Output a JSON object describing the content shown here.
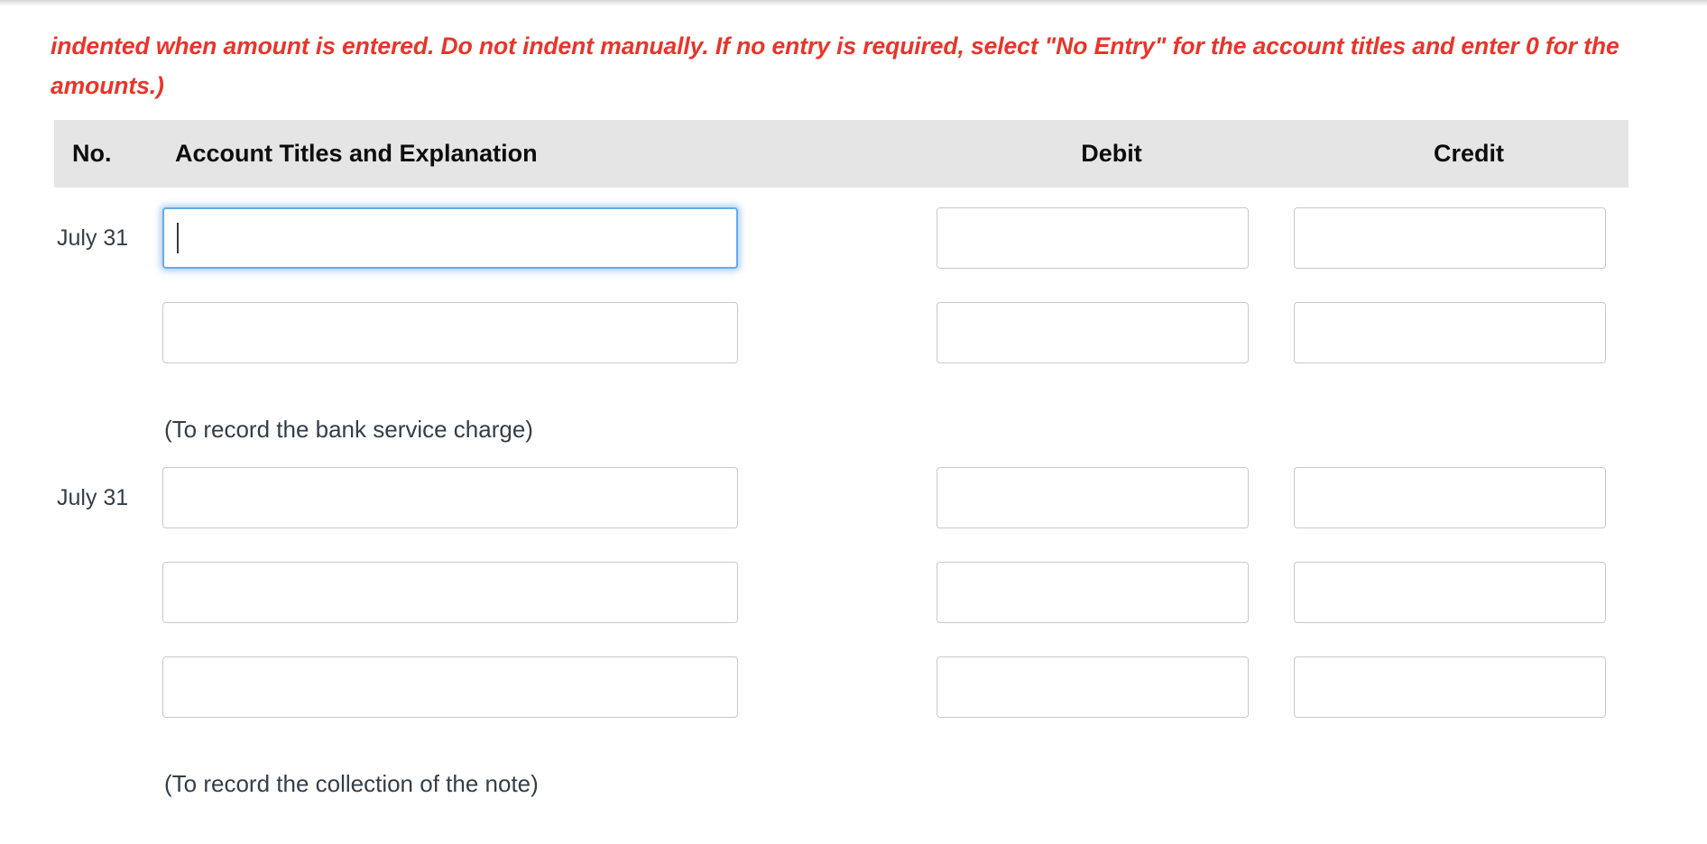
{
  "instructions": {
    "text": "indented when amount is entered. Do not indent manually. If no entry is required, select \"No Entry\" for the account titles and enter 0 for the amounts.)",
    "color": "#e8352a"
  },
  "journal": {
    "header": {
      "background": "#e5e5e5",
      "columns": [
        {
          "key": "no",
          "label": "No."
        },
        {
          "key": "account",
          "label": "Account Titles and Explanation"
        },
        {
          "key": "debit",
          "label": "Debit"
        },
        {
          "key": "credit",
          "label": "Credit"
        }
      ]
    },
    "focus_color": "#6aa9e9",
    "border_color": "#c9c9c9",
    "rows": [
      {
        "kind": "entry",
        "date": "July 31",
        "account": {
          "value": "",
          "placeholder": "",
          "focused": true
        },
        "debit": {
          "value": "",
          "placeholder": "",
          "focused": false
        },
        "credit": {
          "value": "",
          "placeholder": "",
          "focused": false
        }
      },
      {
        "kind": "entry",
        "date": "",
        "account": {
          "value": "",
          "placeholder": "",
          "focused": false
        },
        "debit": {
          "value": "",
          "placeholder": "",
          "focused": false
        },
        "credit": {
          "value": "",
          "placeholder": "",
          "focused": false
        }
      },
      {
        "kind": "memo",
        "text": "(To record the bank service charge)"
      },
      {
        "kind": "entry",
        "date": "July 31",
        "account": {
          "value": "",
          "placeholder": "",
          "focused": false
        },
        "debit": {
          "value": "",
          "placeholder": "",
          "focused": false
        },
        "credit": {
          "value": "",
          "placeholder": "",
          "focused": false
        }
      },
      {
        "kind": "entry",
        "date": "",
        "account": {
          "value": "",
          "placeholder": "",
          "focused": false
        },
        "debit": {
          "value": "",
          "placeholder": "",
          "focused": false
        },
        "credit": {
          "value": "",
          "placeholder": "",
          "focused": false
        }
      },
      {
        "kind": "entry",
        "date": "",
        "account": {
          "value": "",
          "placeholder": "",
          "focused": false
        },
        "debit": {
          "value": "",
          "placeholder": "",
          "focused": false
        },
        "credit": {
          "value": "",
          "placeholder": "",
          "focused": false
        }
      },
      {
        "kind": "memo",
        "text": "(To record the collection of the note)"
      }
    ]
  }
}
